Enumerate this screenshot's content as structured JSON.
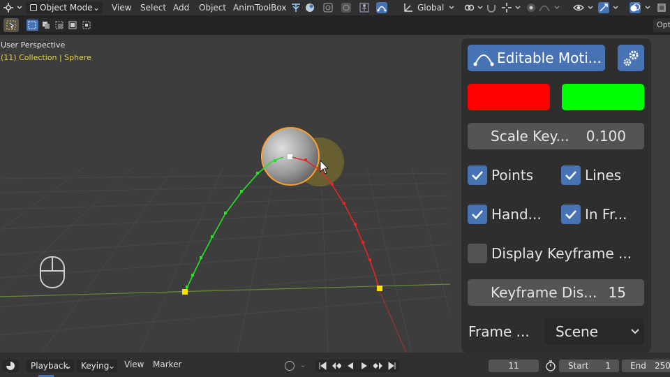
{
  "topbar": {
    "mode": "Object Mode",
    "menus": [
      "View",
      "Select",
      "Add",
      "Object",
      "AnimToolBox"
    ],
    "orientation": "Global",
    "options_label": "Opt"
  },
  "viewport": {
    "perspective": "User Perspective",
    "collection": "(11) Collection | Sphere",
    "colors": {
      "background": "#3d3d3d",
      "motion_before": "#27e327",
      "motion_after": "#e32727",
      "keyframe": "#ffe000",
      "selection": "#ffa030"
    }
  },
  "panel": {
    "editable_motion_label": "Editable Moti...",
    "color_before": "#ff0000",
    "color_after": "#00ff00",
    "scale_label": "Scale Key...",
    "scale_value": "0.100",
    "points_label": "Points",
    "lines_label": "Lines",
    "handles_label": "Hand...",
    "infront_label": "In Fr...",
    "display_keyframe_label": "Display Keyframe ...",
    "keyframe_dis_label": "Keyframe Dis...",
    "keyframe_dis_value": "15",
    "frame_label": "Frame ...",
    "frame_select_value": "Scene"
  },
  "timeline": {
    "playback": "Playback",
    "keying": "Keying",
    "view": "View",
    "marker": "Marker",
    "current_frame": "11",
    "start_label": "Start",
    "start_value": "1",
    "end_label": "End",
    "end_value": "250"
  }
}
